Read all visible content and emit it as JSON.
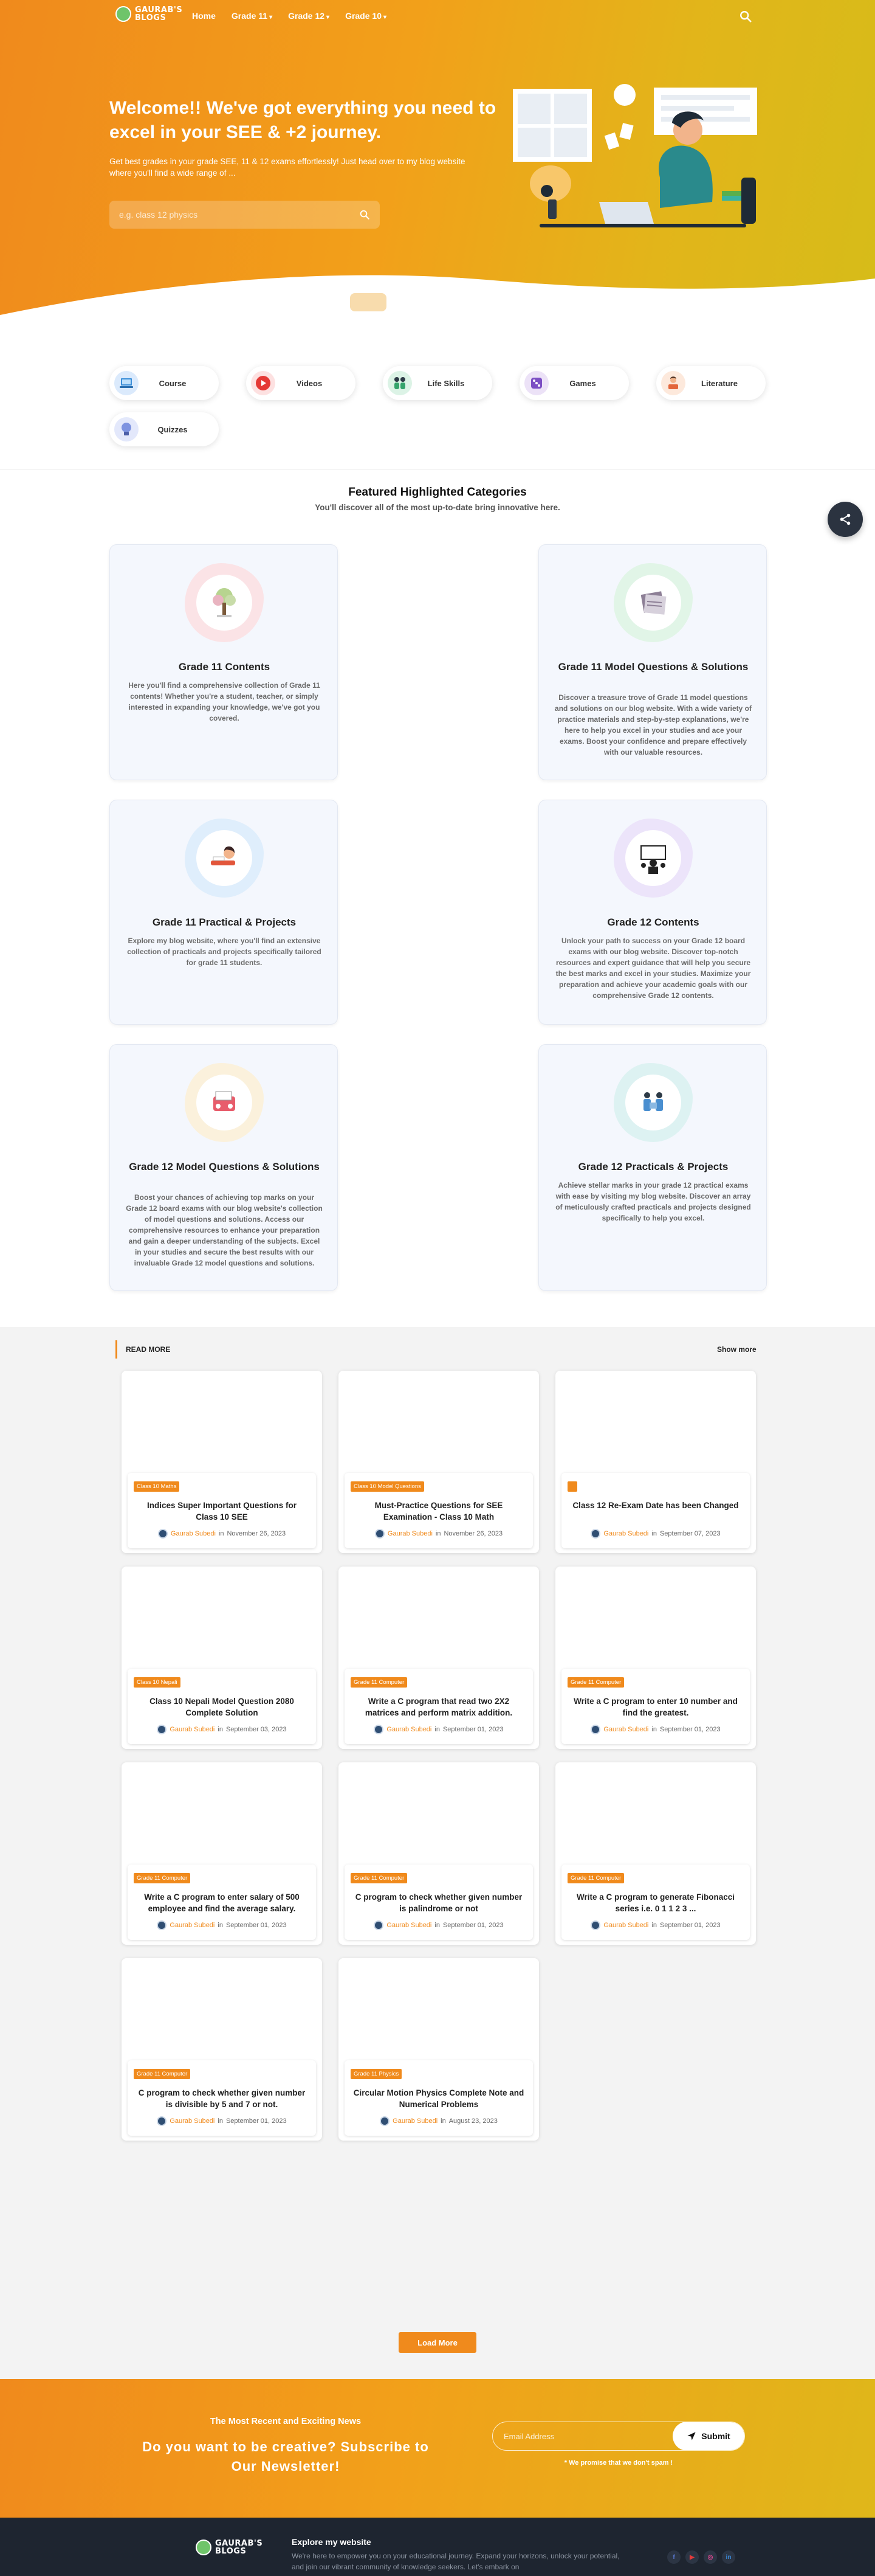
{
  "brand": {
    "logo_line1": "GAURAB'S",
    "logo_line2": "BLOGS"
  },
  "nav": {
    "items": [
      {
        "label": "Home",
        "caret": ""
      },
      {
        "label": "Grade 11",
        "caret": "▾"
      },
      {
        "label": "Grade 12",
        "caret": "▾"
      },
      {
        "label": "Grade 10",
        "caret": "▾"
      }
    ]
  },
  "hero": {
    "title": "Welcome!! We've got everything you need to excel in your SEE & +2 journey.",
    "subtitle": "Get best grades in your grade SEE, 11 & 12 exams effortlessly! Just head over to my blog website where you'll find a wide range of ...",
    "search_placeholder": "e.g. class 12 physics"
  },
  "quick_links": [
    {
      "label": "Course",
      "icon": "laptop-icon",
      "bg": "#dbeafc"
    },
    {
      "label": "Videos",
      "icon": "youtube-icon",
      "bg": "#fde1e1"
    },
    {
      "label": "Life Skills",
      "icon": "people-icon",
      "bg": "#dcf3e6"
    },
    {
      "label": "Games",
      "icon": "dice-icon",
      "bg": "#ece2f7"
    },
    {
      "label": "Literature",
      "icon": "reader-icon",
      "bg": "#fde9dc"
    },
    {
      "label": "Quizzes",
      "icon": "bulb-icon",
      "bg": "#e3e8fb"
    }
  ],
  "featured": {
    "title": "Featured Highlighted Categories",
    "subtitle": "You'll discover all of the most up-to-date bring innovative here.",
    "cards": [
      {
        "title": "Grade 11 Contents",
        "desc": "Here you'll find a comprehensive collection of Grade 11 contents! Whether you're a student, teacher, or simply interested in expanding your knowledge, we've got you covered.",
        "blob": "#fbe3e6",
        "icon": "tree-icon"
      },
      {
        "title": "Grade 11 Model Questions & Solutions",
        "desc": "Discover a treasure trove of Grade 11 model questions and solutions on our blog website. With a wide variety of practice materials and step-by-step explanations, we're here to help you excel in your studies and ace your exams. Boost your confidence and prepare effectively with our valuable resources.",
        "blob": "#e1f5e7",
        "icon": "papers-icon"
      },
      {
        "title": "Grade 11 Practical & Projects",
        "desc": "Explore my blog website, where you'll find an extensive collection of practicals and projects specifically tailored for grade 11 students.",
        "blob": "#dfeefc",
        "icon": "student-icon"
      },
      {
        "title": "Grade 12 Contents",
        "desc": "Unlock your path to success on your Grade 12 board exams with our blog website. Discover top-notch resources and expert guidance that will help you secure the best marks and excel in your studies. Maximize your preparation and achieve your academic goals with our comprehensive Grade 12 contents.",
        "blob": "#ece4fa",
        "icon": "teacher-icon"
      },
      {
        "title": "Grade 12 Model Questions & Solutions",
        "desc": "Boost your chances of achieving top marks on your Grade 12 board exams with our blog website's collection of model questions and solutions. Access our comprehensive resources to enhance your preparation and gain a deeper understanding of the subjects. Excel in your studies and secure the best results with our invaluable Grade 12 model questions and solutions.",
        "blob": "#fbf1dc",
        "icon": "exam-icon"
      },
      {
        "title": "Grade 12 Practicals & Projects",
        "desc": "Achieve stellar marks in your grade 12 practical exams with ease by visiting my blog website. Discover an array of meticulously crafted practicals and projects designed specifically to help you excel.",
        "blob": "#ddf2f2",
        "icon": "team-icon"
      }
    ]
  },
  "read_more": {
    "heading": "READ MORE",
    "show_more": "Show more",
    "load_more": "Load More",
    "posts": [
      {
        "tag": "Class 10 Maths",
        "title": "Indices Super Important Questions for Class 10 SEE",
        "author": "Gaurab Subedi",
        "in": "in",
        "date": "November 26, 2023"
      },
      {
        "tag": "Class 10 Model Questions",
        "title": "Must-Practice Questions for SEE Examination - Class 10 Math",
        "author": "Gaurab Subedi",
        "in": "in",
        "date": "November 26, 2023"
      },
      {
        "tag": "",
        "title": "Class 12 Re-Exam Date has been Changed",
        "author": "Gaurab Subedi",
        "in": "in",
        "date": "September 07, 2023"
      },
      {
        "tag": "Class 10 Nepali",
        "title": "Class 10 Nepali Model Question 2080 Complete Solution",
        "author": "Gaurab Subedi",
        "in": "in",
        "date": "September 03, 2023"
      },
      {
        "tag": "Grade 11 Computer",
        "title": "Write a C program that read two 2X2 matrices and perform matrix addition.",
        "author": "Gaurab Subedi",
        "in": "in",
        "date": "September 01, 2023"
      },
      {
        "tag": "Grade 11 Computer",
        "title": "Write a C program to enter 10 number and find the greatest.",
        "author": "Gaurab Subedi",
        "in": "in",
        "date": "September 01, 2023"
      },
      {
        "tag": "Grade 11 Computer",
        "title": "Write a C program to enter salary of 500 employee and find the average salary.",
        "author": "Gaurab Subedi",
        "in": "in",
        "date": "September 01, 2023"
      },
      {
        "tag": "Grade 11 Computer",
        "title": "C program to check whether given number is palindrome or not",
        "author": "Gaurab Subedi",
        "in": "in",
        "date": "September 01, 2023"
      },
      {
        "tag": "Grade 11 Computer",
        "title": "Write a C program to generate Fibonacci series i.e. 0 1 1 2 3 ...",
        "author": "Gaurab Subedi",
        "in": "in",
        "date": "September 01, 2023"
      },
      {
        "tag": "Grade 11 Computer",
        "title": "C program to check whether given number is divisible by 5 and 7 or not.",
        "author": "Gaurab Subedi",
        "in": "in",
        "date": "September 01, 2023"
      },
      {
        "tag": "Grade 11 Physics",
        "title": "Circular Motion Physics Complete Note and Numerical Problems",
        "author": "Gaurab Subedi",
        "in": "in",
        "date": "August 23, 2023"
      }
    ]
  },
  "newsletter": {
    "kicker": "The Most Recent and Exciting News",
    "title": "Do you want to be creative? Subscribe to Our Newsletter!",
    "email_placeholder": "Email Address",
    "submit": "Submit",
    "promise": "* We promise that we don't spam !"
  },
  "footer": {
    "heading": "Explore my website",
    "text": "We're here to empower you on your educational journey. Expand your horizons, unlock your potential, and join our vibrant community of knowledge seekers. Let's embark on",
    "socials": [
      {
        "icon": "facebook-icon",
        "glyph": "f",
        "color": "#5b7bd5"
      },
      {
        "icon": "youtube-icon",
        "glyph": "▶",
        "color": "#e33b3b"
      },
      {
        "icon": "instagram-icon",
        "glyph": "◎",
        "color": "#d9488f"
      },
      {
        "icon": "linkedin-icon",
        "glyph": "in",
        "color": "#3b8ad9"
      }
    ]
  },
  "colors": {
    "accent": "#f08a1c",
    "hero_end": "#d6bc19",
    "footer_bg": "#1e2530"
  }
}
